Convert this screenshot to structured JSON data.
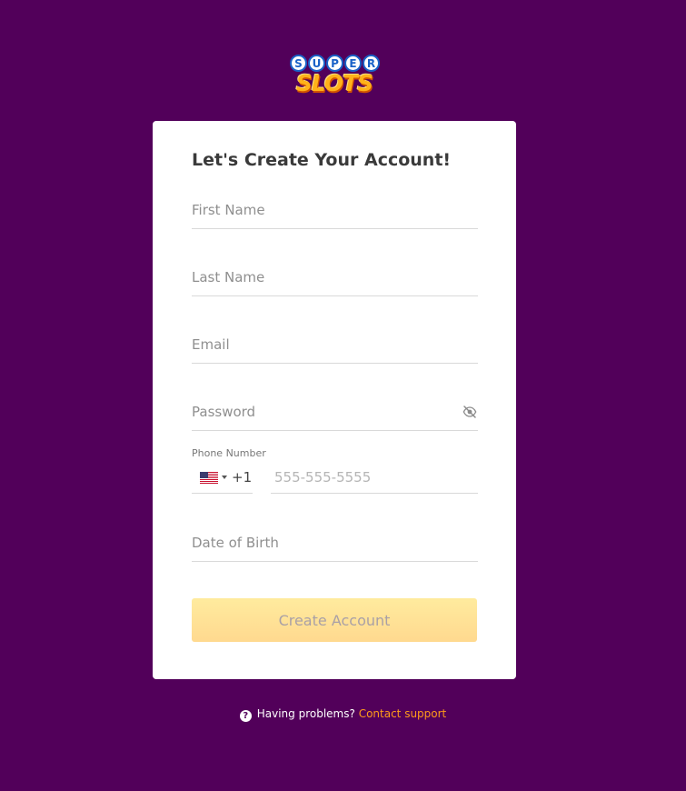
{
  "brand": {
    "logo_top": "SUPER",
    "logo_top_letters": [
      "S",
      "U",
      "P",
      "E",
      "R"
    ],
    "logo_bottom": "SLOTS",
    "colors": {
      "background": "#52005a",
      "logo_blue": "#1a62c8",
      "logo_orange": "#ffb21a",
      "link_orange": "#ff9a1a",
      "button_yellow": "#ffe39a"
    }
  },
  "form": {
    "title": "Let's Create Your Account!",
    "first_name": {
      "placeholder": "First Name",
      "value": ""
    },
    "last_name": {
      "placeholder": "Last Name",
      "value": ""
    },
    "email": {
      "placeholder": "Email",
      "value": ""
    },
    "password": {
      "placeholder": "Password",
      "value": "",
      "toggle_icon": "eye-off-icon"
    },
    "phone": {
      "label": "Phone Number",
      "country_icon": "us-flag-icon",
      "dial_code": "+1",
      "placeholder": "555-555-5555",
      "value": ""
    },
    "dob": {
      "placeholder": "Date of Birth",
      "value": ""
    },
    "submit_label": "Create Account"
  },
  "footer": {
    "icon": "question-circle-icon",
    "help_text": "Having problems?",
    "support_link": "Contact support"
  }
}
